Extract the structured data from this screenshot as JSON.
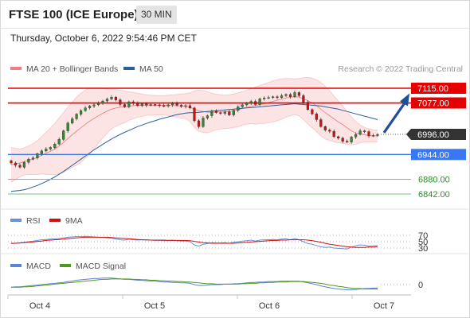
{
  "header": {
    "title": "FTSE 100 (ICE Europe)",
    "interval": "30 MIN",
    "timestamp": "Thursday, October 6, 2022 9:54:46 PM CET"
  },
  "colors": {
    "resistance": "#e60000",
    "support": "#3a78f2",
    "target": "#2e8b2e",
    "bollinger": "#f08080",
    "ma50": "#2e5e9e",
    "bull": "#2e8b2e",
    "bear": "#cc1111",
    "arrow": "#1f4e9a",
    "price_tag": "#333333",
    "rsi": "#6a8fd8",
    "rsi_ma": "#d01010",
    "macd": "#5b84d6",
    "macd_signal": "#4e9a1e"
  },
  "main_legend": {
    "bollinger_label": "MA 20 + Bollinger Bands",
    "ma50_label": "MA 50",
    "credit": "Research © 2022 Trading Central"
  },
  "rsi_legend": {
    "rsi_label": "RSI",
    "ma_label": "9MA"
  },
  "macd_legend": {
    "macd_label": "MACD",
    "signal_label": "MACD Signal"
  },
  "x_labels": [
    "Oct 4",
    "Oct 5",
    "Oct 6",
    "Oct 7"
  ],
  "rsi_axis_labels": [
    "70",
    "50",
    "30"
  ],
  "macd_axis_label": "0",
  "chart_data": {
    "type": "candlestick",
    "levels": [
      {
        "label": "7115.00",
        "value": 7115,
        "kind": "resistance"
      },
      {
        "label": "7077.00",
        "value": 7077,
        "kind": "resistance"
      },
      {
        "label": "6996.00",
        "value": 6996,
        "kind": "last_price"
      },
      {
        "label": "6944.00",
        "value": 6944,
        "kind": "support"
      },
      {
        "label": "6880.00",
        "value": 6880,
        "kind": "target"
      },
      {
        "label": "6842.00",
        "value": 6842,
        "kind": "target"
      }
    ],
    "close": [
      6922,
      6916,
      6911,
      6924,
      6932,
      6935,
      6946,
      6953,
      6958,
      6962,
      6971,
      6983,
      7005,
      7025,
      7036,
      7048,
      7057,
      7064,
      7069,
      7072,
      7076,
      7082,
      7087,
      7092,
      7085,
      7073,
      7067,
      7080,
      7076,
      7070,
      7075,
      7071,
      7073,
      7072,
      7070,
      7069,
      7072,
      7076,
      7071,
      7068,
      7070,
      7064,
      7031,
      7016,
      7038,
      7044,
      7056,
      7052,
      7050,
      7054,
      7046,
      7058,
      7067,
      7072,
      7077,
      7081,
      7073,
      7088,
      7090,
      7091,
      7093,
      7091,
      7096,
      7099,
      7093,
      7104,
      7096,
      7079,
      7060,
      7049,
      7034,
      7016,
      7007,
      7004,
      6990,
      6986,
      6978,
      6976,
      6989,
      6996,
      7005,
      7003,
      6992,
      6993,
      6996
    ],
    "bollinger_mid": [
      6917,
      6920,
      6922,
      6926,
      6929,
      6932,
      6936,
      6942,
      6947,
      6952,
      6958,
      6966,
      6975,
      6985,
      6995,
      7004,
      7013,
      7022,
      7030,
      7037,
      7044,
      7050,
      7056,
      7061,
      7064,
      7066,
      7067,
      7069,
      7070,
      7071,
      7071,
      7072,
      7071,
      7071,
      7071,
      7071,
      7071,
      7070,
      7070,
      7069,
      7069,
      7066,
      7061,
      7057,
      7055,
      7053,
      7053,
      7054,
      7054,
      7054,
      7055,
      7057,
      7059,
      7063,
      7066,
      7069,
      7070,
      7073,
      7075,
      7078,
      7081,
      7084,
      7087,
      7090,
      7092,
      7093,
      7092,
      7088,
      7083,
      7077,
      7070,
      7061,
      7052,
      7044,
      7036,
      7028,
      7021,
      7013,
      7005,
      7000,
      6997,
      6995,
      6993,
      6992,
      6992
    ],
    "bollinger_upper": [
      6962,
      6960,
      6958,
      6961,
      6966,
      6972,
      6980,
      6990,
      7001,
      7012,
      7024,
      7038,
      7052,
      7066,
      7079,
      7092,
      7102,
      7110,
      7115,
      7116,
      7115,
      7114,
      7113,
      7112,
      7111,
      7110,
      7108,
      7106,
      7104,
      7102,
      7100,
      7098,
      7097,
      7096,
      7096,
      7096,
      7097,
      7098,
      7099,
      7100,
      7101,
      7103,
      7108,
      7110,
      7109,
      7106,
      7102,
      7100,
      7098,
      7097,
      7098,
      7100,
      7103,
      7106,
      7110,
      7114,
      7118,
      7122,
      7126,
      7130,
      7134,
      7137,
      7139,
      7140,
      7140,
      7139,
      7140,
      7142,
      7143,
      7141,
      7137,
      7130,
      7120,
      7108,
      7095,
      7082,
      7069,
      7055,
      7041,
      7029,
      7020,
      7014,
      7010,
      7008,
      7007
    ],
    "bollinger_lower": [
      6872,
      6880,
      6886,
      6891,
      6892,
      6892,
      6892,
      6894,
      6893,
      6892,
      6892,
      6894,
      6898,
      6904,
      6911,
      6916,
      6924,
      6934,
      6945,
      6958,
      6973,
      6986,
      6999,
      7010,
      7017,
      7022,
      7026,
      7032,
      7036,
      7040,
      7042,
      7046,
      7045,
      7046,
      7046,
      7046,
      7045,
      7042,
      7041,
      7038,
      7037,
      7029,
      7014,
      7004,
      7001,
      7000,
      7004,
      7008,
      7010,
      7011,
      7012,
      7014,
      7015,
      7020,
      7022,
      7024,
      7022,
      7024,
      7024,
      7026,
      7028,
      7031,
      7035,
      7040,
      7044,
      7047,
      7044,
      7034,
      7023,
      7013,
      7003,
      6992,
      6984,
      6980,
      6977,
      6974,
      6973,
      6971,
      6969,
      6971,
      6974,
      6976,
      6976,
      6976,
      6977
    ],
    "ma50": [
      6849,
      6850,
      6851,
      6853,
      6856,
      6860,
      6864,
      6869,
      6874,
      6880,
      6886,
      6893,
      6900,
      6908,
      6916,
      6924,
      6932,
      6940,
      6948,
      6956,
      6963,
      6970,
      6977,
      6984,
      6990,
      6996,
      7001,
      7006,
      7011,
      7016,
      7020,
      7024,
      7028,
      7031,
      7035,
      7038,
      7041,
      7044,
      7047,
      7049,
      7051,
      7052,
      7052,
      7053,
      7054,
      7055,
      7056,
      7057,
      7058,
      7059,
      7060,
      7061,
      7062,
      7063,
      7064,
      7065,
      7066,
      7067,
      7068,
      7069,
      7070,
      7071,
      7072,
      7073,
      7074,
      7075,
      7074,
      7073,
      7072,
      7071,
      7070,
      7069,
      7067,
      7065,
      7063,
      7061,
      7058,
      7055,
      7052,
      7049,
      7046,
      7043,
      7040,
      7037,
      7034
    ],
    "rsi": [
      44,
      45,
      46,
      48,
      50,
      52,
      54,
      56,
      57,
      58,
      59,
      60,
      62,
      64,
      65,
      66,
      66,
      67,
      66,
      65,
      64,
      63,
      62,
      61,
      58,
      56,
      55,
      58,
      56,
      55,
      56,
      55,
      55,
      54,
      54,
      53,
      54,
      55,
      53,
      52,
      52,
      50,
      40,
      36,
      42,
      44,
      47,
      46,
      46,
      47,
      45,
      48,
      50,
      52,
      53,
      55,
      52,
      55,
      56,
      56,
      57,
      56,
      58,
      59,
      56,
      60,
      56,
      50,
      44,
      42,
      38,
      34,
      32,
      33,
      30,
      29,
      28,
      27,
      33,
      37,
      40,
      39,
      36,
      37,
      38
    ],
    "rsi_ma": [
      45,
      45,
      46,
      47,
      48,
      49,
      51,
      52,
      54,
      55,
      56,
      57,
      58,
      60,
      61,
      62,
      63,
      64,
      64,
      64,
      64,
      64,
      64,
      63,
      62,
      61,
      60,
      59,
      58,
      57,
      56,
      56,
      55,
      55,
      55,
      55,
      54,
      54,
      54,
      54,
      54,
      53,
      51,
      49,
      47,
      46,
      45,
      45,
      45,
      45,
      45,
      45,
      46,
      47,
      48,
      49,
      50,
      51,
      52,
      53,
      54,
      54,
      55,
      55,
      56,
      56,
      56,
      56,
      55,
      53,
      51,
      48,
      45,
      42,
      40,
      38,
      36,
      34,
      33,
      32,
      32,
      32,
      33,
      33,
      34
    ],
    "macd": [
      -6,
      -5,
      -5,
      -4,
      -3,
      -2,
      -1,
      0,
      1,
      2,
      3,
      4,
      5,
      7,
      8,
      10,
      11,
      12,
      13,
      14,
      14,
      15,
      15,
      15,
      14,
      13,
      12,
      12,
      11,
      10,
      10,
      9,
      8,
      8,
      7,
      6,
      6,
      5,
      5,
      4,
      4,
      3,
      0,
      -2,
      -2,
      -1,
      0,
      0,
      0,
      1,
      1,
      2,
      2,
      3,
      4,
      5,
      5,
      6,
      6,
      7,
      7,
      7,
      8,
      8,
      8,
      8,
      8,
      6,
      4,
      2,
      0,
      -3,
      -5,
      -7,
      -9,
      -10,
      -11,
      -12,
      -12,
      -11,
      -10,
      -9,
      -9,
      -8,
      -8
    ],
    "macd_signal": [
      -6,
      -6,
      -6,
      -5,
      -5,
      -4,
      -3,
      -2,
      -1,
      0,
      1,
      2,
      3,
      4,
      5,
      6,
      7,
      8,
      9,
      10,
      11,
      12,
      12,
      13,
      13,
      13,
      13,
      13,
      12,
      12,
      11,
      11,
      10,
      10,
      9,
      9,
      8,
      8,
      7,
      7,
      6,
      6,
      5,
      4,
      3,
      2,
      2,
      1,
      1,
      1,
      1,
      1,
      1,
      2,
      2,
      3,
      3,
      4,
      4,
      5,
      5,
      6,
      6,
      6,
      7,
      7,
      7,
      7,
      6,
      5,
      4,
      3,
      1,
      -1,
      -2,
      -4,
      -5,
      -7,
      -8,
      -9,
      -9,
      -10,
      -10,
      -10,
      -10
    ]
  }
}
